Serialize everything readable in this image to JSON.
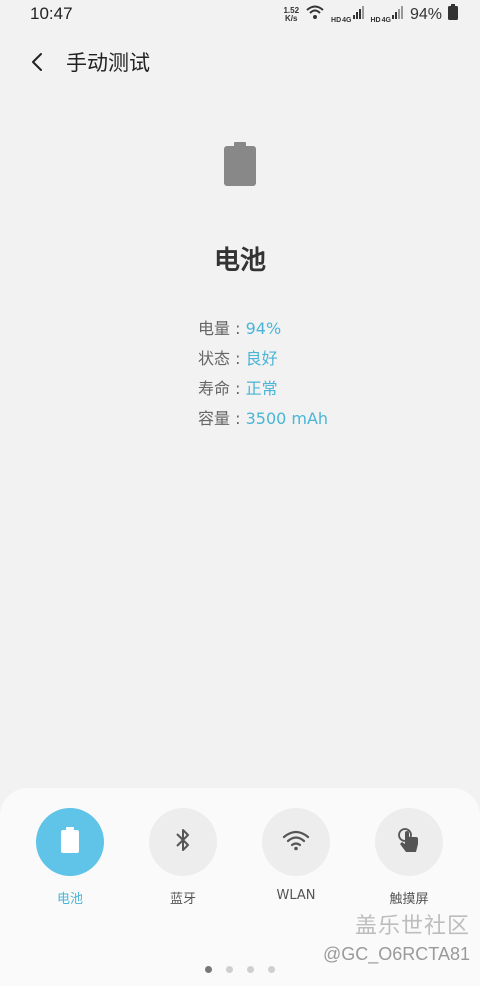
{
  "status_bar": {
    "time": "10:47",
    "net_speed_value": "1.52",
    "net_speed_unit": "K/s",
    "hd_label": "HD",
    "network_type": "4G",
    "battery_percent": "94%"
  },
  "header": {
    "title": "手动测试"
  },
  "main": {
    "title": "电池",
    "info": [
      {
        "label": "电量",
        "sep": " : ",
        "value": "94%"
      },
      {
        "label": "状态",
        "sep": " : ",
        "value": "良好"
      },
      {
        "label": "寿命",
        "sep": " : ",
        "value": "正常"
      },
      {
        "label": "容量",
        "sep": " : ",
        "value": "3500 mAh"
      }
    ]
  },
  "tests": [
    {
      "label": "电池",
      "icon": "battery-icon",
      "active": true
    },
    {
      "label": "蓝牙",
      "icon": "bluetooth-icon",
      "active": false
    },
    {
      "label": "WLAN",
      "icon": "wifi-icon",
      "active": false
    },
    {
      "label": "触摸屏",
      "icon": "touch-icon",
      "active": false
    }
  ],
  "watermark": {
    "title": "盖乐世社区",
    "user": "@GC_O6RCTA81"
  },
  "pagination": {
    "total": 4,
    "current": 1
  },
  "colors": {
    "accent": "#4ab5d6",
    "active_circle": "#5fc4e8",
    "background": "#f2f2f2"
  }
}
